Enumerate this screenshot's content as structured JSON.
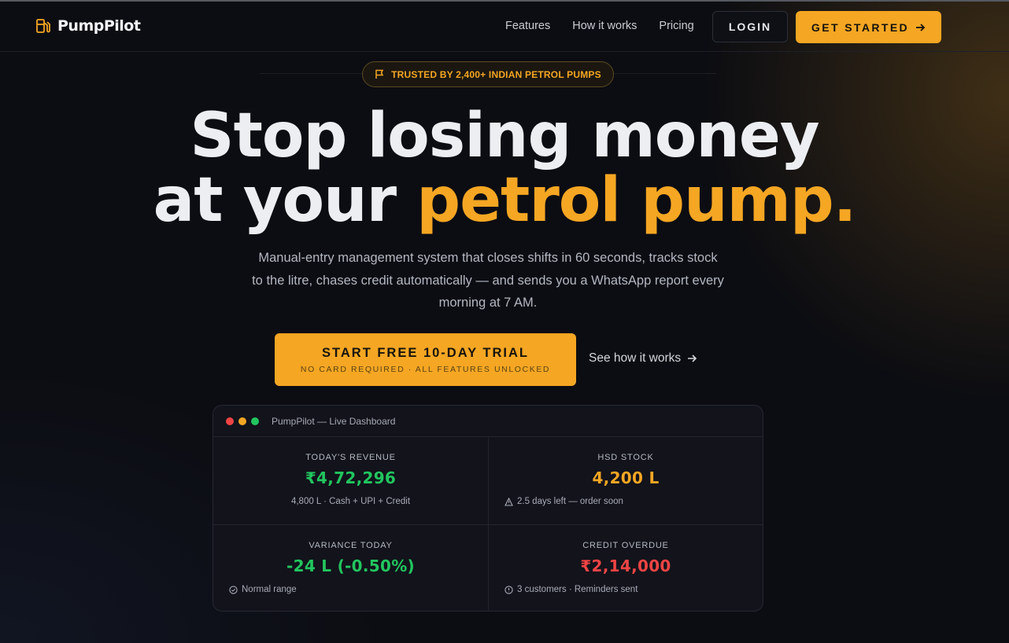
{
  "nav": {
    "brand": "PumpPilot",
    "links": [
      "Features",
      "How it works",
      "Pricing"
    ],
    "login": "LOGIN",
    "get_started": "GET STARTED"
  },
  "badge": "TRUSTED BY 2,400+ INDIAN PETROL PUMPS",
  "hero": {
    "line1": "Stop losing money",
    "line2_plain": "at your",
    "line2_accent": "petrol pump.",
    "subtitle": "Manual-entry management system that closes shifts in 60 seconds, tracks stock to the litre, chases credit automatically — and sends you a WhatsApp report every morning at 7 AM.",
    "cta_main": "START FREE 10-DAY TRIAL",
    "cta_sub": "NO CARD REQUIRED · ALL FEATURES UNLOCKED",
    "secondary_link": "See how it works"
  },
  "dashboard": {
    "title": "PumpPilot — Live Dashboard",
    "cards": [
      {
        "label": "TODAY'S REVENUE",
        "value": "₹4,72,296",
        "note": "4,800 L · Cash + UPI + Credit"
      },
      {
        "label": "HSD STOCK",
        "value": "4,200 L",
        "note": "2.5 days left — order soon"
      },
      {
        "label": "VARIANCE TODAY",
        "value": "-24 L (-0.50%)",
        "note": "Normal range"
      },
      {
        "label": "CREDIT OVERDUE",
        "value": "₹2,14,000",
        "note": "3 customers · Reminders sent"
      }
    ]
  },
  "colors": {
    "accent": "#f5a623",
    "positive": "#22c55e",
    "negative": "#ef4444",
    "background": "#0c0d12"
  }
}
